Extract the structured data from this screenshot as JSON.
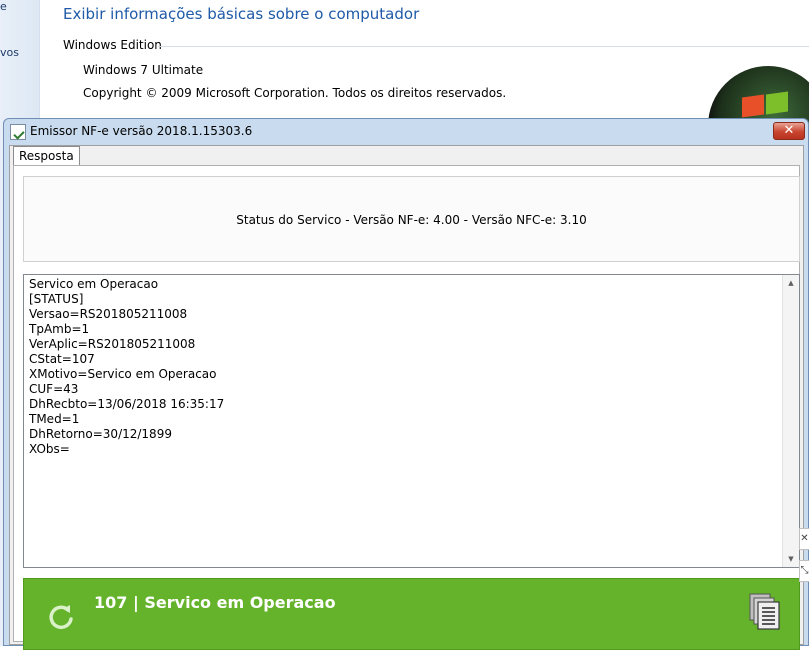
{
  "background_window": {
    "sidebar_fragments": [
      "e",
      "vos"
    ],
    "title": "Exibir informações básicas sobre o computador",
    "section_label": "Windows Edition",
    "edition": "Windows 7 Ultimate",
    "copyright": "Copyright © 2009 Microsoft Corporation. Todos os direitos reservados."
  },
  "dialog": {
    "title": "Emissor NF-e versão 2018.1.15303.6",
    "close_glyph": "✕",
    "tab_label": "Resposta",
    "status_text": "Status do Servico - Versão NF-e: 4.00 - Versão NFC-e:  3.10",
    "response_lines": [
      "Servico em Operacao",
      "[STATUS]",
      "Versao=RS201805211008",
      "TpAmb=1",
      "VerAplic=RS201805211008",
      "CStat=107",
      "XMotivo=Servico em Operacao",
      "CUF=43",
      "DhRecbto=13/06/2018 16:35:17",
      "TMed=1",
      "DhRetorno=30/12/1899",
      "XObs="
    ],
    "result_text": "107 | Servico em Operacao",
    "result_color": "#64b32b",
    "icons": {
      "refresh": "refresh-icon",
      "copy": "copy-documents-icon"
    }
  }
}
